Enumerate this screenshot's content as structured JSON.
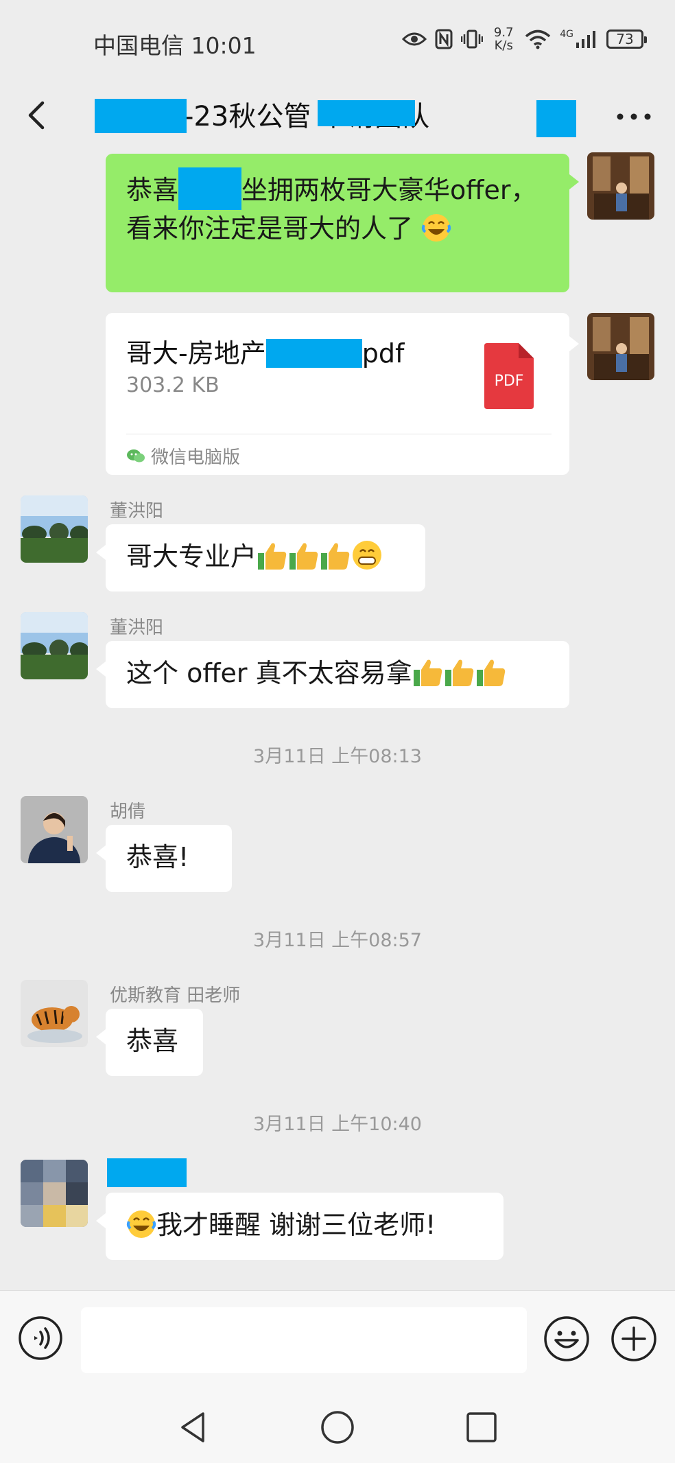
{
  "status_bar": {
    "carrier_time": "中国电信 10:01",
    "net_speed_value": "9.7",
    "net_speed_unit": "K/s",
    "network_type": "4G",
    "battery": "73"
  },
  "header": {
    "title_visible": "-23秋公管    申请团队",
    "back_icon": "chevron-left-icon",
    "more_icon": "more-dots-icon"
  },
  "messages": {
    "m1": {
      "pre": "恭喜",
      "post": "坐拥两枚哥大豪华offer， 看来你注定是哥大的人了"
    },
    "file": {
      "name_pre": "哥大-房地产",
      "name_post": "pdf",
      "size": "303.2 KB",
      "source": "微信电脑版",
      "badge": "PDF"
    },
    "m3": {
      "sender": "董洪阳",
      "text": "哥大专业户"
    },
    "m4": {
      "sender": "董洪阳",
      "text": "这个 offer 真不太容易拿"
    },
    "ts1": "3月11日 上午08:13",
    "m5": {
      "sender": "胡倩",
      "text": "恭喜!"
    },
    "ts2": "3月11日 上午08:57",
    "m6": {
      "sender": "优斯教育 田老师",
      "text": "恭喜"
    },
    "ts3": "3月11日 上午10:40",
    "m7": {
      "text": "我才睡醒 谢谢三位老师!"
    }
  },
  "input_bar": {
    "placeholder": "",
    "icons": [
      "voice-icon",
      "emoji-icon",
      "plus-icon"
    ]
  },
  "nav_bar": {
    "icons": [
      "nav-back-icon",
      "nav-home-icon",
      "nav-recents-icon"
    ]
  },
  "colors": {
    "background": "#ededed",
    "my_bubble": "#95ec69",
    "other_bubble": "#ffffff",
    "redaction": "#00a8ef",
    "pdf_red": "#e5393f"
  }
}
